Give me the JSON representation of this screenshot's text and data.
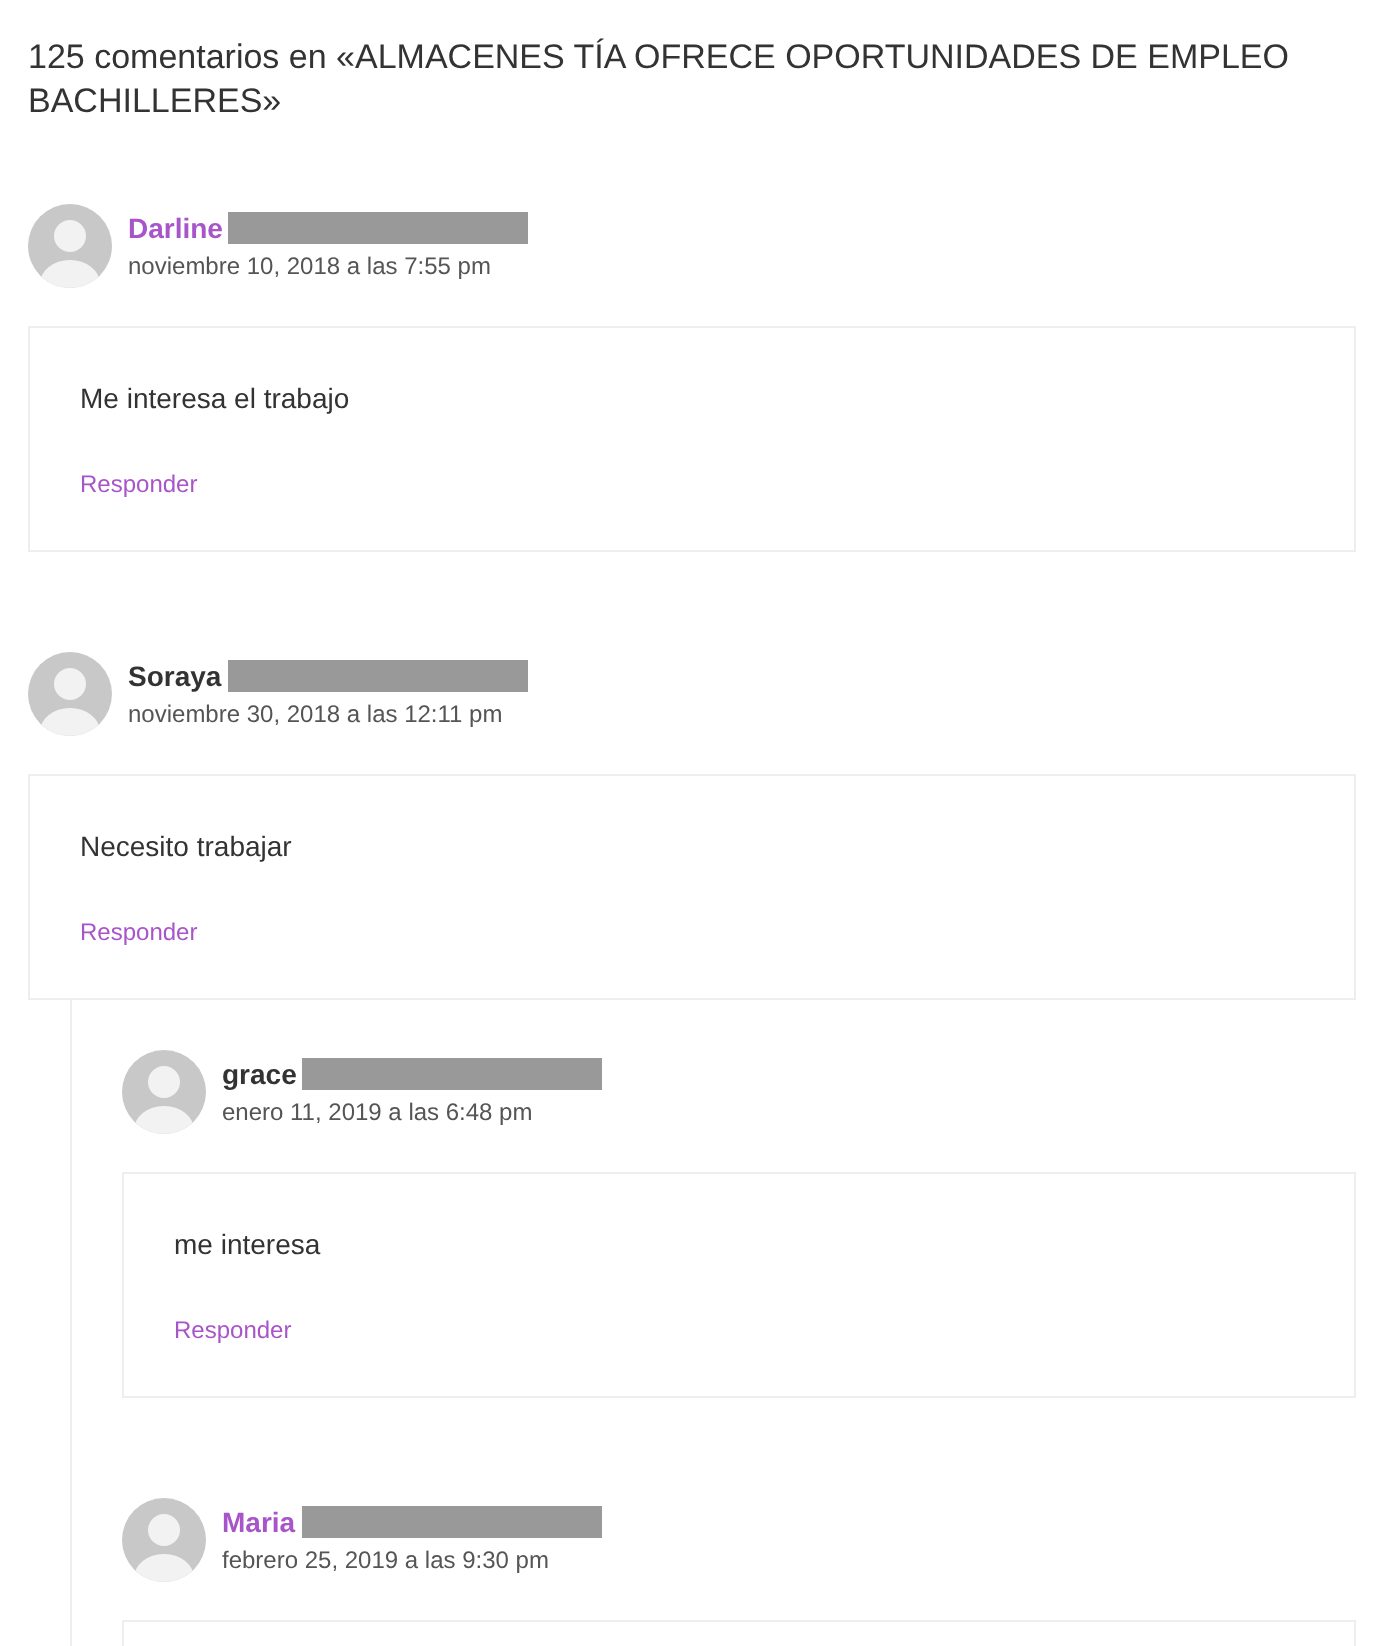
{
  "title": "125 comentarios en «ALMACENES TÍA OFRECE OPORTUNIDADES DE EMPLEO BACHILLERES»",
  "comments": [
    {
      "author": "Darline",
      "linked": true,
      "date": "noviembre 10, 2018 a las 7:55 pm",
      "text": "Me interesa el trabajo",
      "reply": "Responder"
    },
    {
      "author": "Soraya",
      "linked": false,
      "date": "noviembre 30, 2018 a las 12:11 pm",
      "text": "Necesito trabajar",
      "reply": "Responder",
      "children": [
        {
          "author": "grace",
          "linked": false,
          "date": "enero 11, 2019 a las 6:48 pm",
          "text": "me interesa",
          "reply": "Responder"
        },
        {
          "author": "Maria",
          "linked": true,
          "date": "febrero 25, 2019 a las 9:30 pm"
        }
      ]
    }
  ]
}
